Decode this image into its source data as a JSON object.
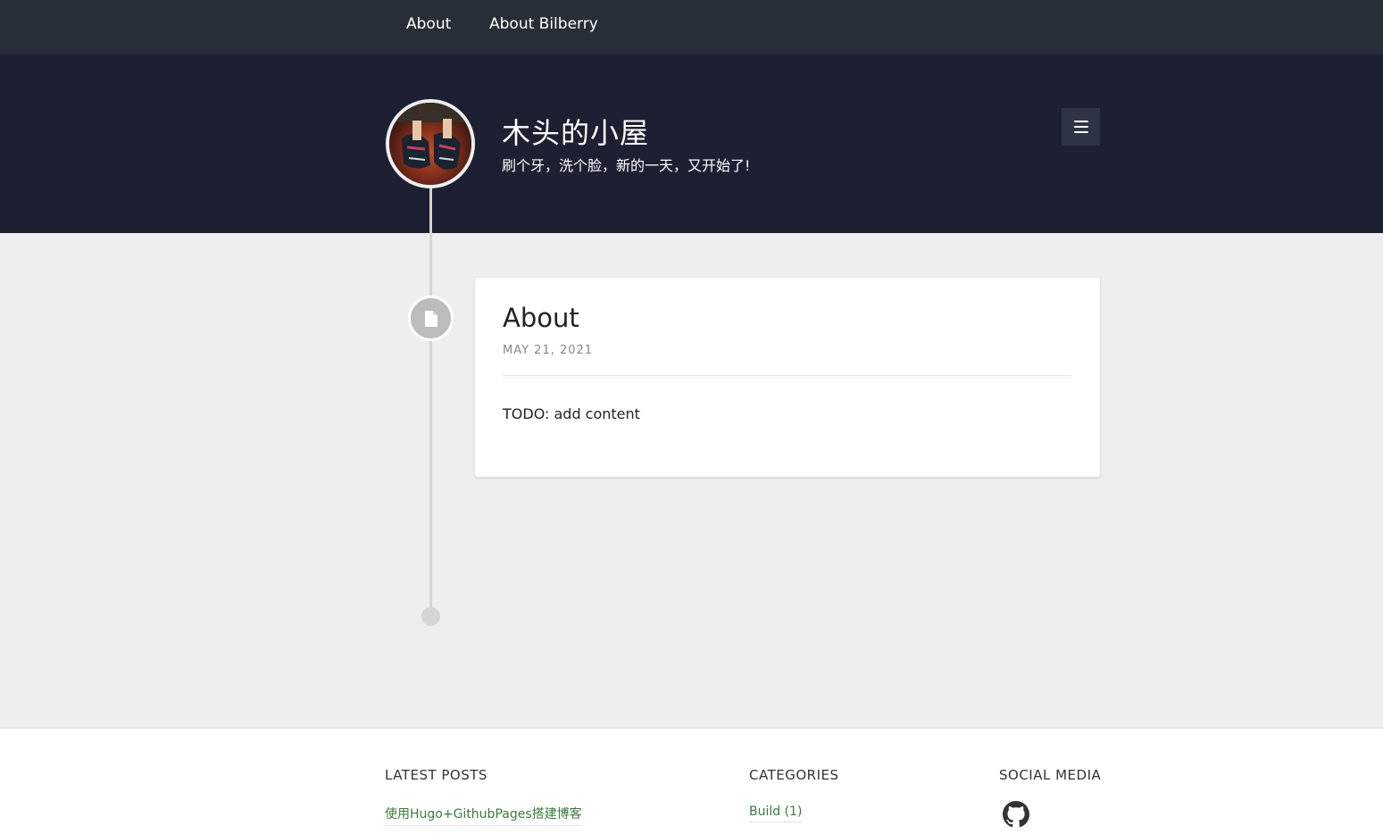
{
  "nav": {
    "items": [
      {
        "label": "About"
      },
      {
        "label": "About Bilberry"
      }
    ]
  },
  "header": {
    "title": "木头的小屋",
    "subtitle": "刷个牙，洗个脸，新的一天，又开始了!"
  },
  "post": {
    "title": "About",
    "date": "MAY 21, 2021",
    "body": "TODO: add content"
  },
  "footer": {
    "latest_posts": {
      "heading": "LATEST POSTS",
      "items": [
        "使用Hugo+GithubPages搭建博客"
      ]
    },
    "categories": {
      "heading": "CATEGORIES",
      "items": [
        "Build (1)"
      ]
    },
    "social_media": {
      "heading": "SOCIAL MEDIA",
      "icons": [
        "github-icon"
      ]
    }
  },
  "colors": {
    "topnav": "#282e38",
    "header": "#1d2033",
    "page": "#eeeeee",
    "link": "#3c7a3c"
  }
}
